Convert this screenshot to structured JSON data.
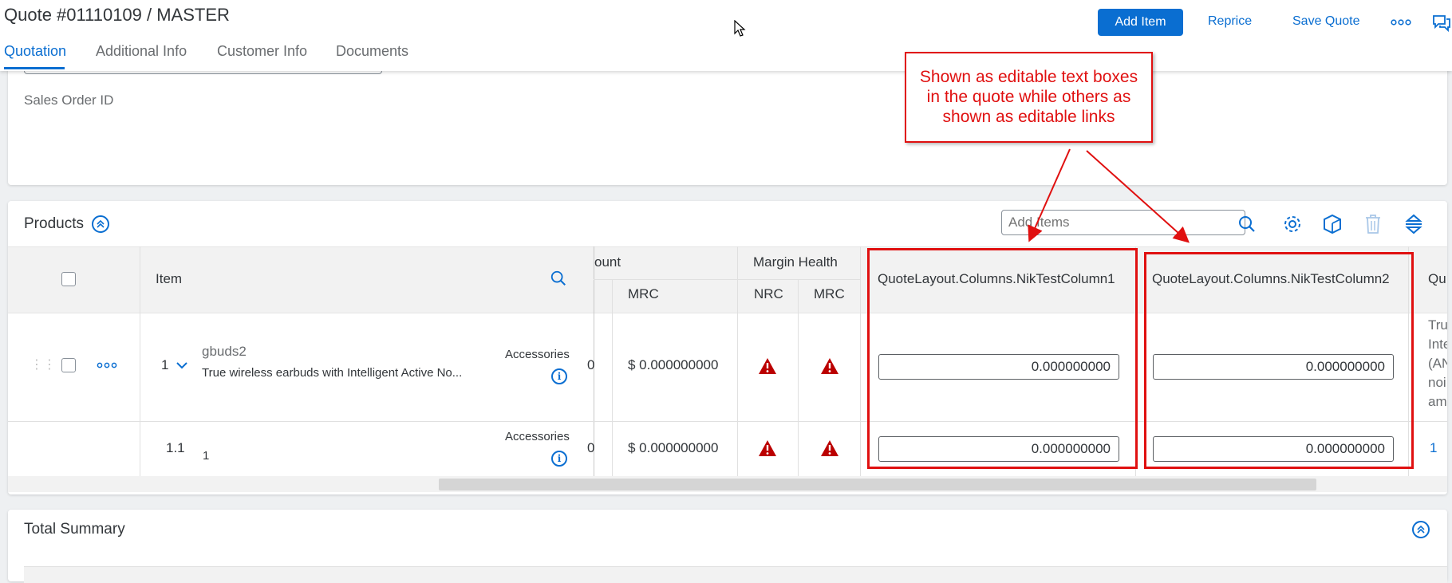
{
  "header": {
    "title": "Quote #01110109 / MASTER",
    "tabs": [
      {
        "label": "Quotation",
        "active": true
      },
      {
        "label": "Additional Info"
      },
      {
        "label": "Customer Info"
      },
      {
        "label": "Documents"
      }
    ],
    "actions": {
      "add_item": "Add Item",
      "reprice": "Reprice",
      "save_quote": "Save Quote"
    }
  },
  "top_panel": {
    "sales_order_label": "Sales Order ID"
  },
  "products": {
    "title": "Products",
    "search_placeholder": "Add Items",
    "columns": {
      "item": "Item",
      "discount_fragment": "ount",
      "mrc": "MRC",
      "margin_health": "Margin Health",
      "nrc": "NRC",
      "mrc2": "MRC",
      "custom1": "QuoteLayout.Columns.NikTestColumn1",
      "custom2": "QuoteLayout.Columns.NikTestColumn2",
      "qu_fragment": "Qu"
    },
    "rows": [
      {
        "number": "1",
        "name": "gbuds2",
        "description": "True wireless earbuds with Intelligent Active No...",
        "category": "Accessories",
        "discount_fragment": "0",
        "mrc": "$ 0.000000000",
        "custom1": "0.000000000",
        "custom2": "0.000000000",
        "overflow_lines": [
          "Tru",
          "Inte",
          "(AN",
          "noi",
          "am"
        ]
      },
      {
        "number": "1.1",
        "name": "1",
        "category": "Accessories",
        "discount_fragment": "0",
        "mrc": "$ 0.000000000",
        "custom1": "0.000000000",
        "custom2": "0.000000000",
        "overflow": "1"
      }
    ]
  },
  "annotation": {
    "lines": [
      "Shown as editable text boxes",
      "in the quote while others as",
      "shown as editable links"
    ]
  },
  "summary": {
    "title": "Total Summary"
  },
  "colors": {
    "accent": "#0a6ed1",
    "annotation": "#e01010",
    "warning": "#bb0000"
  }
}
